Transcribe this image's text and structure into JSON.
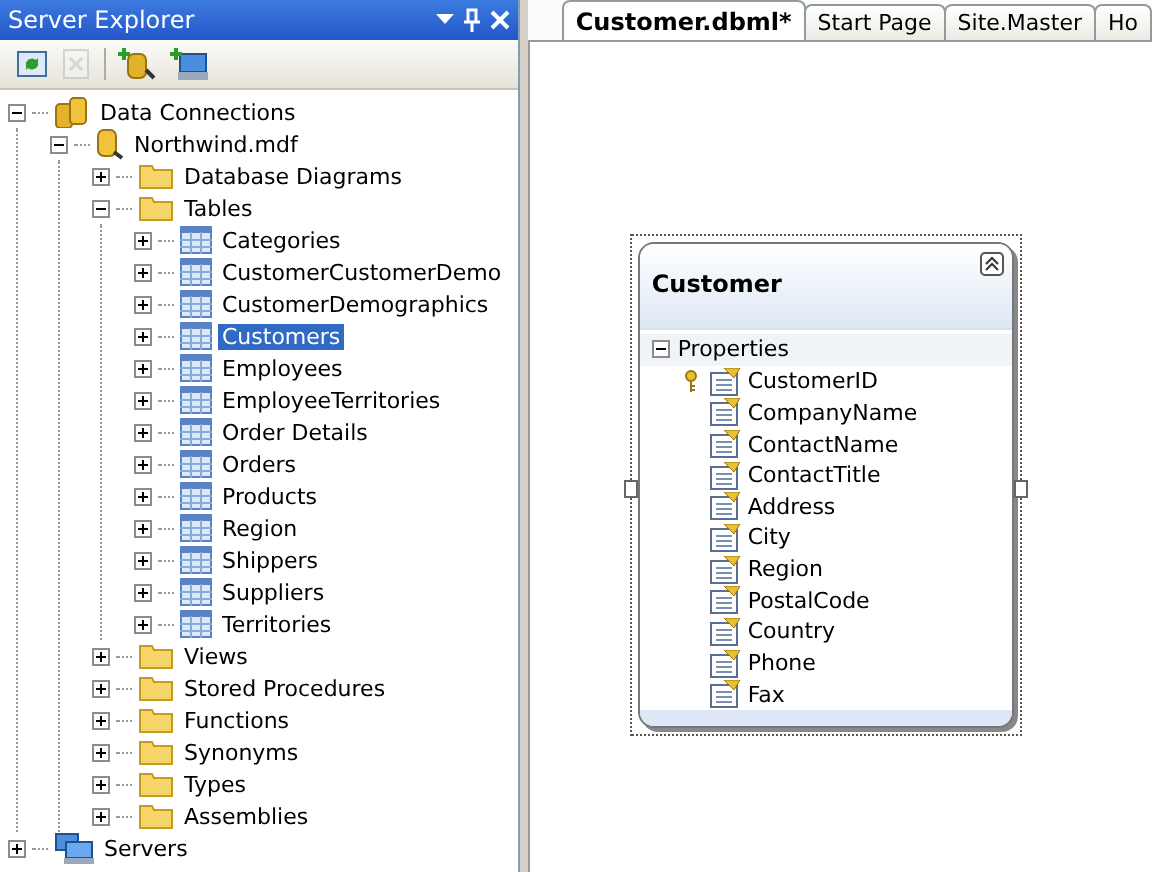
{
  "panel": {
    "title": "Server Explorer",
    "toolbar": [
      {
        "kind": "refresh",
        "disabled": false
      },
      {
        "kind": "delete",
        "disabled": true
      },
      {
        "kind": "add-connection",
        "disabled": false
      },
      {
        "kind": "add-server",
        "disabled": false
      }
    ]
  },
  "tree": [
    {
      "label": "Data Connections",
      "kind": "connections",
      "expanded": true,
      "selected": false,
      "children": [
        {
          "label": "Northwind.mdf",
          "kind": "database",
          "expanded": true,
          "selected": false,
          "children": [
            {
              "label": "Database Diagrams",
              "kind": "folder",
              "expanded": false,
              "selected": false
            },
            {
              "label": "Tables",
              "kind": "folder",
              "expanded": true,
              "selected": false,
              "children": [
                {
                  "label": "Categories",
                  "kind": "table",
                  "expanded": false,
                  "selected": false
                },
                {
                  "label": "CustomerCustomerDemo",
                  "kind": "table",
                  "expanded": false,
                  "selected": false
                },
                {
                  "label": "CustomerDemographics",
                  "kind": "table",
                  "expanded": false,
                  "selected": false
                },
                {
                  "label": "Customers",
                  "kind": "table",
                  "expanded": false,
                  "selected": true
                },
                {
                  "label": "Employees",
                  "kind": "table",
                  "expanded": false,
                  "selected": false
                },
                {
                  "label": "EmployeeTerritories",
                  "kind": "table",
                  "expanded": false,
                  "selected": false
                },
                {
                  "label": "Order Details",
                  "kind": "table",
                  "expanded": false,
                  "selected": false
                },
                {
                  "label": "Orders",
                  "kind": "table",
                  "expanded": false,
                  "selected": false
                },
                {
                  "label": "Products",
                  "kind": "table",
                  "expanded": false,
                  "selected": false
                },
                {
                  "label": "Region",
                  "kind": "table",
                  "expanded": false,
                  "selected": false
                },
                {
                  "label": "Shippers",
                  "kind": "table",
                  "expanded": false,
                  "selected": false
                },
                {
                  "label": "Suppliers",
                  "kind": "table",
                  "expanded": false,
                  "selected": false
                },
                {
                  "label": "Territories",
                  "kind": "table",
                  "expanded": false,
                  "selected": false
                }
              ]
            },
            {
              "label": "Views",
              "kind": "folder",
              "expanded": false,
              "selected": false
            },
            {
              "label": "Stored Procedures",
              "kind": "folder",
              "expanded": false,
              "selected": false
            },
            {
              "label": "Functions",
              "kind": "folder",
              "expanded": false,
              "selected": false
            },
            {
              "label": "Synonyms",
              "kind": "folder",
              "expanded": false,
              "selected": false
            },
            {
              "label": "Types",
              "kind": "folder",
              "expanded": false,
              "selected": false
            },
            {
              "label": "Assemblies",
              "kind": "folder",
              "expanded": false,
              "selected": false
            }
          ]
        }
      ]
    },
    {
      "label": "Servers",
      "kind": "server",
      "expanded": false,
      "selected": false
    }
  ],
  "tabs": [
    {
      "label": "Customer.dbml*",
      "selected": true
    },
    {
      "label": "Start Page",
      "selected": false
    },
    {
      "label": "Site.Master",
      "selected": false
    },
    {
      "label": "Ho",
      "selected": false
    }
  ],
  "entity": {
    "title": "Customer",
    "section": "Properties",
    "expanded": true,
    "properties": [
      {
        "name": "CustomerID",
        "key": true
      },
      {
        "name": "CompanyName",
        "key": false
      },
      {
        "name": "ContactName",
        "key": false
      },
      {
        "name": "ContactTitle",
        "key": false
      },
      {
        "name": "Address",
        "key": false
      },
      {
        "name": "City",
        "key": false
      },
      {
        "name": "Region",
        "key": false
      },
      {
        "name": "PostalCode",
        "key": false
      },
      {
        "name": "Country",
        "key": false
      },
      {
        "name": "Phone",
        "key": false
      },
      {
        "name": "Fax",
        "key": false
      }
    ]
  }
}
